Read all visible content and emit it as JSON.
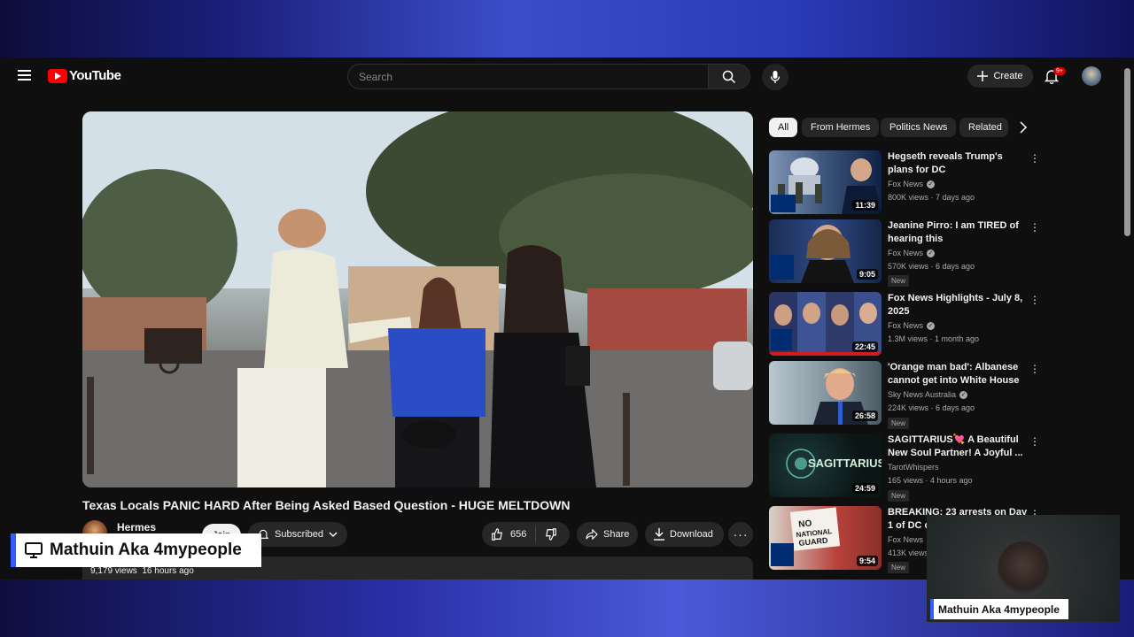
{
  "header": {
    "logo_text": "YouTube",
    "search_placeholder": "Search",
    "create_label": "Create",
    "notification_count": "9+"
  },
  "video": {
    "title": "Texas Locals PANIC HARD After Being Asked Based Question - HUGE MELTDOWN",
    "channel_name": "Hermes",
    "join_label": "Join",
    "subscribed_label": "Subscribed",
    "likes": "656",
    "share_label": "Share",
    "download_label": "Download",
    "views": "9,179 views",
    "posted": "16 hours ago"
  },
  "chips": [
    "All",
    "From Hermes",
    "Politics News",
    "Related"
  ],
  "recommendations": [
    {
      "title": "Hegseth reveals Trump's plans for DC",
      "channel": "Fox News",
      "verified": true,
      "meta": "800K views · 7 days ago",
      "duration": "11:39",
      "new": false,
      "thumb_color": "#1d3a6b"
    },
    {
      "title": "Jeanine Pirro: I am TIRED of hearing this",
      "channel": "Fox News",
      "verified": true,
      "meta": "570K views · 6 days ago",
      "duration": "9:05",
      "new": true,
      "thumb_color": "#1a2d55"
    },
    {
      "title": "Fox News Highlights - July 8, 2025",
      "channel": "Fox News",
      "verified": true,
      "meta": "1.3M views · 1 month ago",
      "duration": "22:45",
      "new": false,
      "thumb_color": "#2a2f5a"
    },
    {
      "title": "'Orange man bad': Albanese cannot get into White House f...",
      "channel": "Sky News Australia",
      "verified": true,
      "meta": "224K views · 6 days ago",
      "duration": "26:58",
      "new": true,
      "thumb_color": "#5a6f7a"
    },
    {
      "title": "SAGITTARIUS💘 A Beautiful New Soul Partner! A Joyful ...",
      "channel": "TarotWhispers",
      "verified": false,
      "meta": "165 views · 4 hours ago",
      "duration": "24:59",
      "new": true,
      "thumb_color": "#0d1a1a"
    },
    {
      "title": "BREAKING: 23 arrests on Day 1 of DC cri",
      "channel": "Fox News",
      "verified": false,
      "meta": "413K views",
      "duration": "9:54",
      "new": true,
      "thumb_color": "#b83a3a"
    }
  ],
  "thumb_text": {
    "fox": "FOX\nNEWS",
    "sagittarius": "SAGITTARIUS",
    "sign": "NO NATIONAL GUARD"
  },
  "overlays": {
    "left_name": "Mathuin Aka 4mypeople",
    "right_name": "Mathuin Aka 4mypeople"
  }
}
